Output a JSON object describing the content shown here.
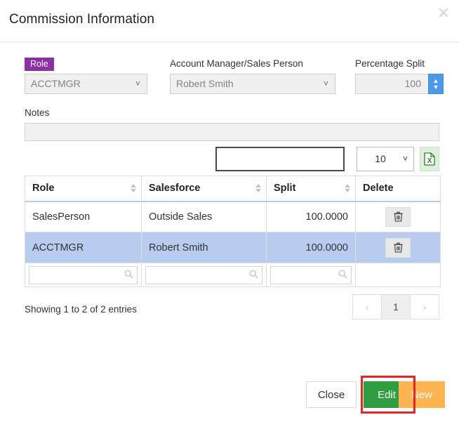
{
  "modal": {
    "title": "Commission Information",
    "close_icon": "close-x-icon"
  },
  "form": {
    "role": {
      "label": "Role",
      "value": "ACCTMGR",
      "caret": "❯"
    },
    "account_manager": {
      "label": "Account Manager/Sales Person",
      "value": "Robert Smith",
      "caret": "❯"
    },
    "percentage_split": {
      "label": "Percentage Split",
      "value": "100",
      "up_icon": "⌃",
      "down_icon": "⌄"
    },
    "notes": {
      "label": "Notes",
      "value": ""
    }
  },
  "toolbar": {
    "search_value": "",
    "search_placeholder": "",
    "page_length": "10",
    "page_length_caret": "❯",
    "excel_icon": "excel-export-icon",
    "excel_letter": "X"
  },
  "table": {
    "columns": [
      {
        "label": "Role",
        "sortable": true
      },
      {
        "label": "Salesforce",
        "sortable": true
      },
      {
        "label": "Split",
        "sortable": true
      },
      {
        "label": "Delete",
        "sortable": false
      }
    ],
    "rows": [
      {
        "role": "SalesPerson",
        "salesforce": "Outside Sales",
        "split": "100.0000",
        "delete_icon": "trash-icon",
        "selected": false
      },
      {
        "role": "ACCTMGR",
        "salesforce": "Robert Smith",
        "split": "100.0000",
        "delete_icon": "trash-icon",
        "selected": true
      }
    ],
    "filters": {
      "role": "",
      "salesforce": "",
      "split": "",
      "search_icon": "magnifier-icon"
    }
  },
  "footer": {
    "showing": "Showing 1 to 2 of 2 entries",
    "pagination": {
      "prev": "‹",
      "pages": [
        "1"
      ],
      "next": "›",
      "current": "1"
    },
    "buttons": {
      "close": "Close",
      "edit": "Edit",
      "new": "New"
    }
  },
  "colors": {
    "role_badge": "#8e2fa5",
    "spinner": "#4a9ae8",
    "edit_button": "#2f9e41",
    "new_button": "#ffb44f",
    "row_selected": "#b8ccef",
    "highlight": "#ee2222",
    "excel_green": "#2f7d32"
  }
}
